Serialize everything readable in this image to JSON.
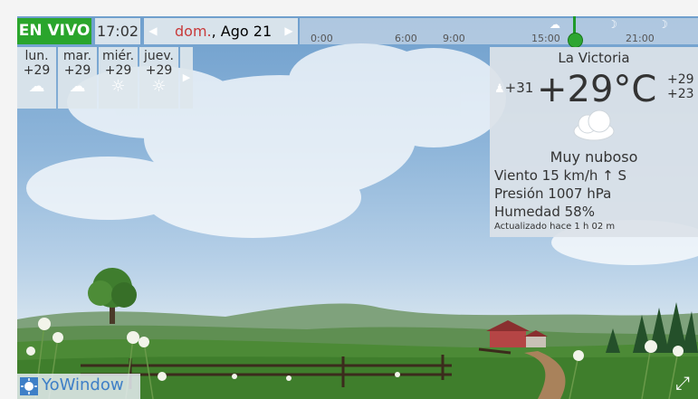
{
  "header": {
    "live_label": "EN VIVO",
    "time": "17:02",
    "day_name": "dom.",
    "date": ", Ago 21",
    "prev_icon": "triangle-left-icon",
    "next_icon": "triangle-right-icon"
  },
  "timeline": {
    "ticks": [
      "0:00",
      "6:00",
      "9:00",
      "15:00",
      "21:00"
    ]
  },
  "forecast": {
    "days": [
      {
        "name": "lun.",
        "temp": "+29",
        "icon": "cloud-icon"
      },
      {
        "name": "mar.",
        "temp": "+29",
        "icon": "cloud-icon"
      },
      {
        "name": "miér.",
        "temp": "+29",
        "icon": "sun-cloud-icon"
      },
      {
        "name": "juev.",
        "temp": "+29",
        "icon": "sun-cloud-icon"
      }
    ],
    "more_icon": "triangle-right-icon"
  },
  "current": {
    "city": "La Victoria",
    "feels_like": "+31",
    "temperature": "+29°C",
    "high": "+29",
    "low": "+23",
    "condition": "Muy nuboso",
    "wind": "Viento  15 km/h  ↑ S",
    "pressure": "Presión  1007 hPa",
    "humidity": "Humedad  58%",
    "updated": "Actualizado  hace 1 h 02 m"
  },
  "brand": {
    "name": "YoWindow"
  },
  "colors": {
    "live": "#2aa52c",
    "day_name": "#c83a3a",
    "brand": "#3e7fc7"
  }
}
